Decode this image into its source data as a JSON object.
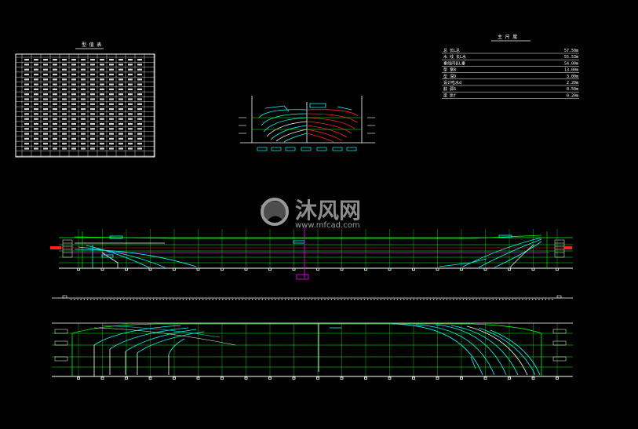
{
  "offset_table": {
    "title": "型 值 表"
  },
  "principal_dimensions": {
    "title": "主 尺 度",
    "rows": [
      {
        "label": "总    长L总",
        "value": "57.50m"
      },
      {
        "label": "水  线  长L水",
        "value": "55.53m"
      },
      {
        "label": "垂线间长L垂",
        "value": "54.00m"
      },
      {
        "label": "型      宽B",
        "value": "13.00m"
      },
      {
        "label": "型      深D",
        "value": "3.00m"
      },
      {
        "label": "设计吃水d",
        "value": "2.20m"
      },
      {
        "label": "舷    弧S",
        "value": "0.50m"
      },
      {
        "label": "梁    拱f",
        "value": "0.20m"
      }
    ]
  },
  "watermark": {
    "brand": "沐风网",
    "url": "www.mfcad.com"
  },
  "colors": {
    "background": "#000000",
    "green": "#00ff00",
    "cyan": "#00ffff",
    "white": "#ffffff",
    "red": "#ff2020",
    "magenta": "#ff00ff",
    "line_grid": "#00c000"
  }
}
